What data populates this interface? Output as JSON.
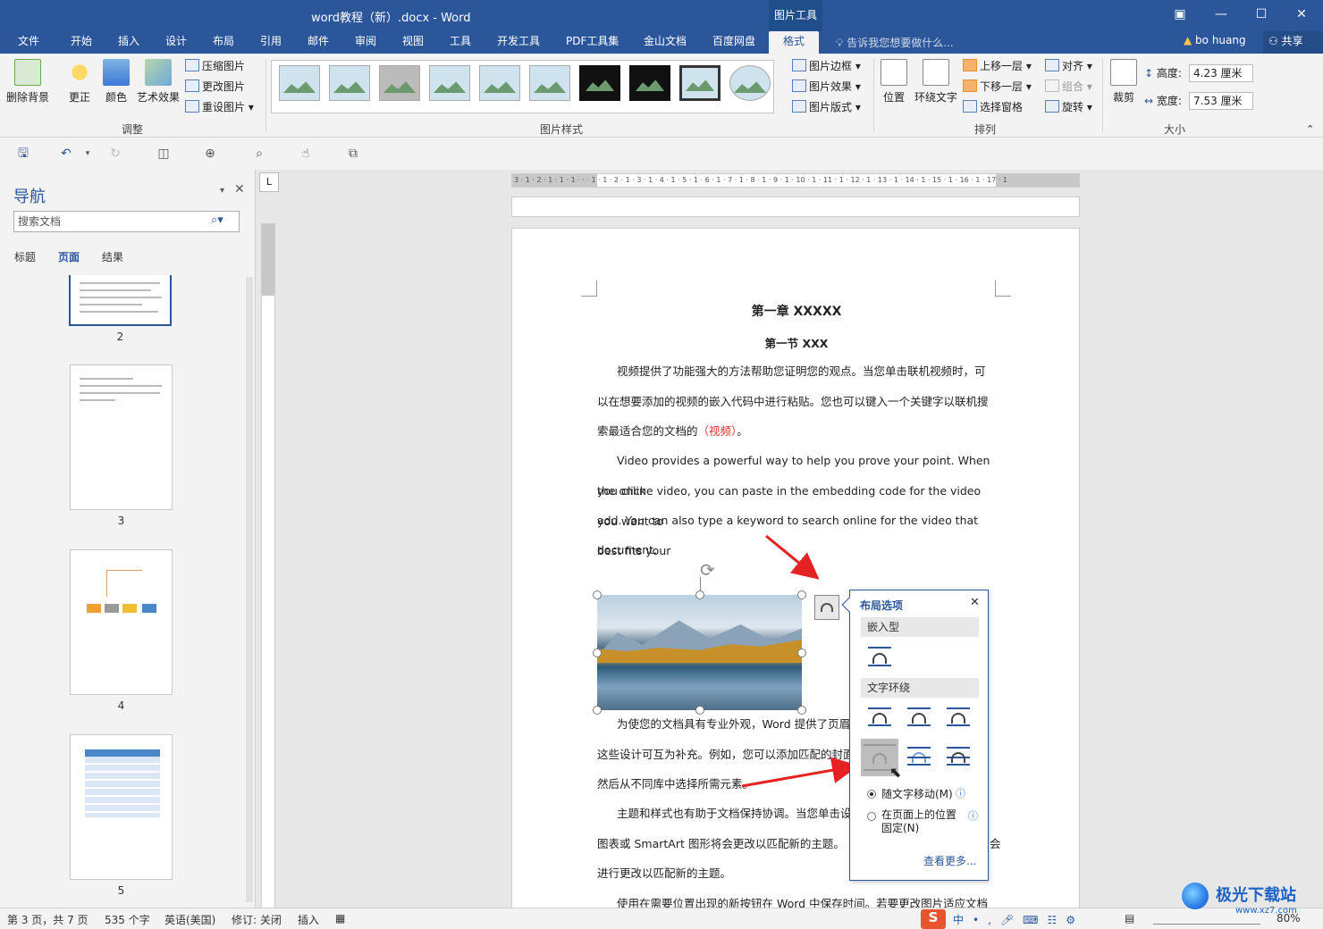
{
  "titlebar": {
    "title": "word教程（新）.docx - Word",
    "context_tab": "图片工具"
  },
  "tabs": [
    "文件",
    "开始",
    "插入",
    "设计",
    "布局",
    "引用",
    "邮件",
    "审阅",
    "视图",
    "工具",
    "开发工具",
    "PDF工具集",
    "金山文档",
    "百度网盘",
    "格式"
  ],
  "tell_me": "告诉我您想要做什么...",
  "user": "bo huang",
  "share": "共享",
  "ribbon": {
    "adjust": {
      "remove_bg": "删除背景",
      "correct": "更正",
      "color": "颜色",
      "artistic": "艺术效果",
      "compress": "压缩图片",
      "change": "更改图片",
      "reset": "重设图片",
      "label": "调整"
    },
    "styles": {
      "border": "图片边框",
      "effects": "图片效果",
      "layout": "图片版式",
      "label": "图片样式"
    },
    "arrange": {
      "position": "位置",
      "wrap": "环绕文字",
      "forward": "上移一层",
      "backward": "下移一层",
      "selection": "选择窗格",
      "align": "对齐",
      "group": "组合",
      "rotate": "旋转",
      "label": "排列"
    },
    "size": {
      "crop": "裁剪",
      "height_label": "高度:",
      "height": "4.23 厘米",
      "width_label": "宽度:",
      "width": "7.53 厘米",
      "label": "大小"
    }
  },
  "nav": {
    "title": "导航",
    "search_placeholder": "搜索文档",
    "tabs": [
      "标题",
      "页面",
      "结果"
    ],
    "pages": [
      "2",
      "3",
      "4",
      "5"
    ]
  },
  "doc": {
    "chapter": "第一章 XXXXX",
    "section": "第一节 XXX",
    "p1a": "视频提供了功能强大的方法帮助您证明您的观点。当您单击联机视频时，可",
    "p1b": "以在想要添加的视频的嵌入代码中进行粘贴。您也可以键入一个关键字以联机搜",
    "p1c": "索最适合您的文档的",
    "p1red": "（视频）",
    "p1end": "。",
    "p2a": "Video provides a powerful way to help you prove your point. When you click",
    "p2b": "the online video, you can paste in the embedding code for the video you want to",
    "p2c": "add. You can also type a keyword to search online for the video that best fits your",
    "p2d": "document.",
    "p3a": "为使您的文档具有专业外观，Word 提供了页眉",
    "p3b": "这些设计可互为补充。例如，您可以添加匹配的封面",
    "p3c": "然后从不同库中选择所需元素。",
    "p4a": "主题和样式也有助于文档保持协调。当您单击设",
    "p4b": "图表或 SmartArt 图形将会更改以匹配新的主题。",
    "p4b_tail": "会",
    "p4c": "进行更改以匹配新的主题。",
    "p5a": "使用在需要位置出现的新按钮在 Word 中保存时间。若要更改图片适应文档"
  },
  "layout_options": {
    "title": "布局选项",
    "inline": "嵌入型",
    "wrap": "文字环绕",
    "move_with_text": "随文字移动(M)",
    "fix_position": "在页面上的位置固定(N)",
    "see_more": "查看更多..."
  },
  "status": {
    "page": "第 3 页，共 7 页",
    "words": "535 个字",
    "lang": "英语(美国)",
    "track": "修订: 关闭",
    "mode": "插入",
    "zoom": "80%",
    "watermark": "极光下载站",
    "watermark_url": "www.xz7.com"
  }
}
